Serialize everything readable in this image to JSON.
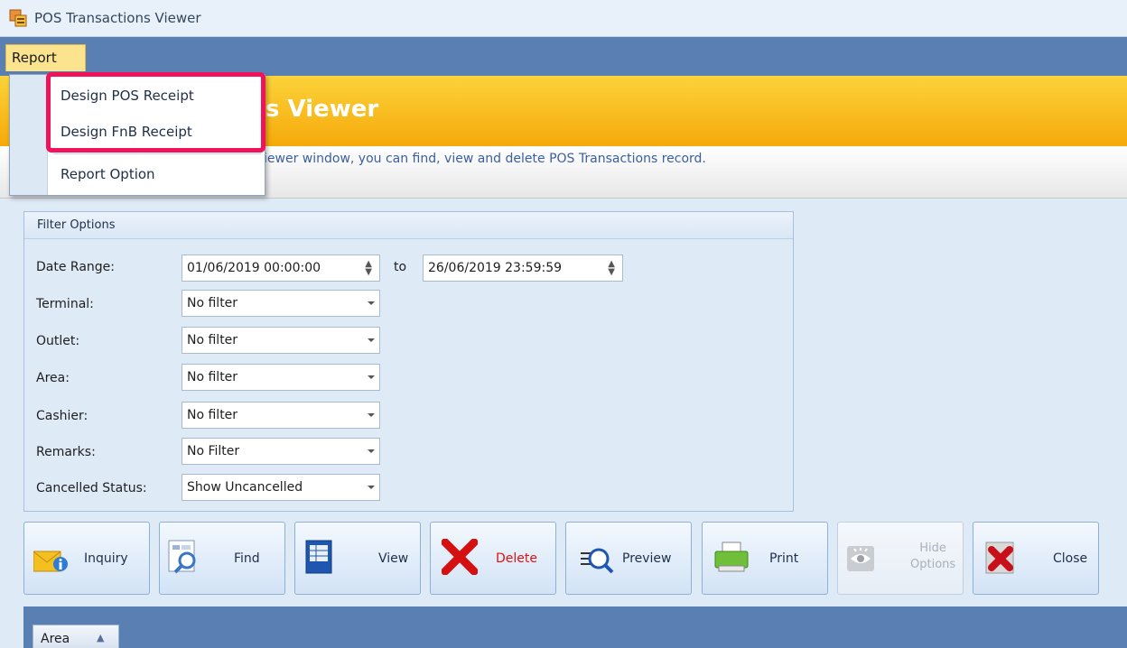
{
  "window": {
    "title": "POS Transactions Viewer"
  },
  "menu": {
    "report_label": "Report",
    "items": [
      "Design POS Receipt",
      "Design FnB Receipt",
      "Report Option"
    ]
  },
  "banner": {
    "title": "POS Transactions Viewer",
    "title_visible": "s Viewer",
    "description_visible": "iewer window, you can find, view and delete POS Transactions record."
  },
  "filter": {
    "heading": "Filter Options",
    "date_range_label": "Date Range:",
    "date_from": "01/06/2019 00:00:00",
    "to_label": "to",
    "date_to": "26/06/2019 23:59:59",
    "terminal_label": "Terminal:",
    "terminal_value": "No filter",
    "outlet_label": "Outlet:",
    "outlet_value": "No filter",
    "area_label": "Area:",
    "area_value": "No filter",
    "cashier_label": "Cashier:",
    "cashier_value": "No filter",
    "remarks_label": "Remarks:",
    "remarks_value": "No Filter",
    "cancelled_label": "Cancelled Status:",
    "cancelled_value": "Show Uncancelled"
  },
  "toolbar": {
    "inquiry": "Inquiry",
    "find": "Find",
    "view": "View",
    "delete": "Delete",
    "preview": "Preview",
    "print": "Print",
    "hide_options_1": "Hide",
    "hide_options_2": "Options",
    "close": "Close"
  },
  "grid": {
    "group_by": "Area"
  },
  "colors": {
    "accent_highlight": "#f0135a",
    "menubar": "#5a7fb2",
    "banner": "#f6a90a",
    "delete_text": "#e01010"
  }
}
